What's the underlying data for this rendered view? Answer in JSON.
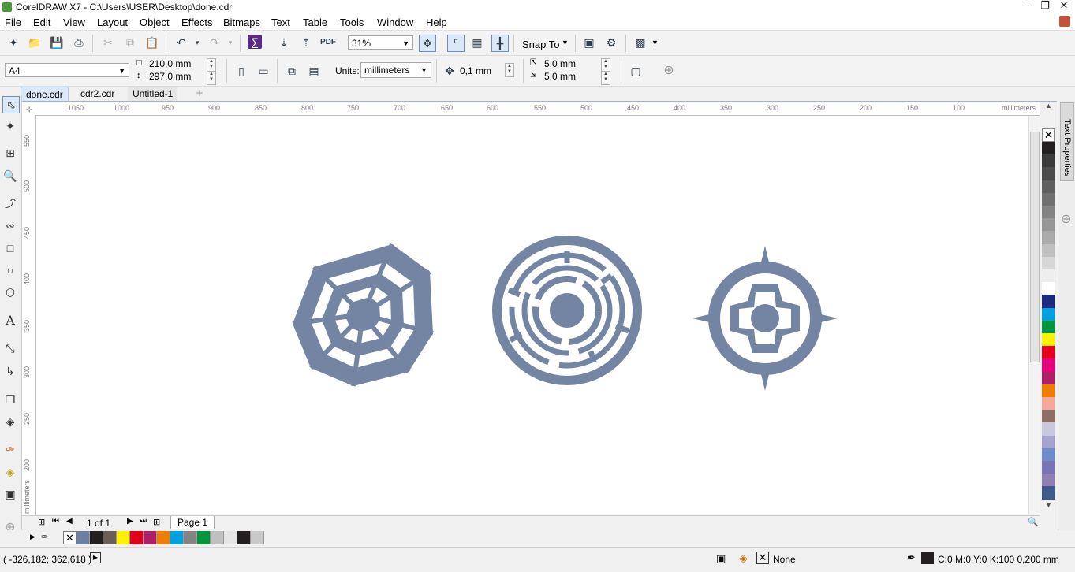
{
  "window": {
    "title": "CorelDRAW X7 - C:\\Users\\USER\\Desktop\\done.cdr"
  },
  "menu": [
    "File",
    "Edit",
    "View",
    "Layout",
    "Object",
    "Effects",
    "Bitmaps",
    "Text",
    "Table",
    "Tools",
    "Window",
    "Help"
  ],
  "standard_toolbar": {
    "zoom": "31%",
    "snap_to": "Snap To",
    "icons": [
      "new-icon",
      "open-icon",
      "save-icon",
      "print-icon",
      "cut-icon",
      "copy-icon",
      "paste-icon",
      "undo-icon",
      "redo-icon",
      "corel-connect-icon",
      "import-icon",
      "export-icon",
      "publish-pdf-icon",
      "zoom-level-select",
      "full-screen-icon",
      "show-rulers-icon",
      "show-grid-icon",
      "show-guidelines-icon",
      "snap-to-dropdown",
      "welcome-screen-icon",
      "options-icon",
      "application-launcher-icon"
    ]
  },
  "property_bar": {
    "page_size": "A4",
    "width": "210,0 mm",
    "height": "297,0 mm",
    "units_label": "Units:",
    "units": "millimeters",
    "nudge": "0,1 mm",
    "dup_x": "5,0 mm",
    "dup_y": "5,0 mm"
  },
  "tabs": [
    "done.cdr",
    "cdr2.cdr",
    "Untitled-1"
  ],
  "ruler": {
    "unit": "millimeters",
    "h_ticks": [
      "1050",
      "1000",
      "950",
      "900",
      "850",
      "800",
      "750",
      "700",
      "650",
      "600",
      "550",
      "500",
      "450",
      "400",
      "350",
      "300",
      "250",
      "200",
      "150",
      "100"
    ],
    "v_ticks": [
      "550",
      "500",
      "450",
      "400",
      "350",
      "300",
      "250",
      "200"
    ]
  },
  "page_nav": {
    "counter": "1 of 1",
    "page_tab": "Page 1"
  },
  "docker": {
    "title": "Text Properties"
  },
  "status": {
    "coords": "( -326,182; 362,618 )",
    "fill": "None",
    "outline": "C:0 M:0 Y:0 K:100  0,200 mm"
  },
  "palette_colors": [
    "#231f20",
    "#3b3b3b",
    "#4d4d4d",
    "#5f5f5f",
    "#707070",
    "#838383",
    "#979797",
    "#ababab",
    "#c0c0c0",
    "#d7d7d7",
    "#eeeeee",
    "#ffffff",
    "#1d2a7d",
    "#00a0e3",
    "#00963f",
    "#fff200",
    "#e4001b",
    "#e5007e",
    "#b01e64",
    "#ef7d00",
    "#f4a9a0",
    "#8c6e63",
    "#c9c8e0",
    "#a7a3cf",
    "#6f8cc8",
    "#7a73b4",
    "#8f7fb2",
    "#3e5a8b"
  ],
  "doc_palette_colors": [
    "#6d7fa0",
    "#231f20",
    "#6b5e57",
    "#fff200",
    "#e4001b",
    "#b01e64",
    "#ef7d00",
    "#00a0e3",
    "#838383",
    "#00963f",
    "#c0c0c0",
    "#e6e6e6",
    "#231f20",
    "#c9c9c9"
  ],
  "artwork_color": "#7385a2"
}
